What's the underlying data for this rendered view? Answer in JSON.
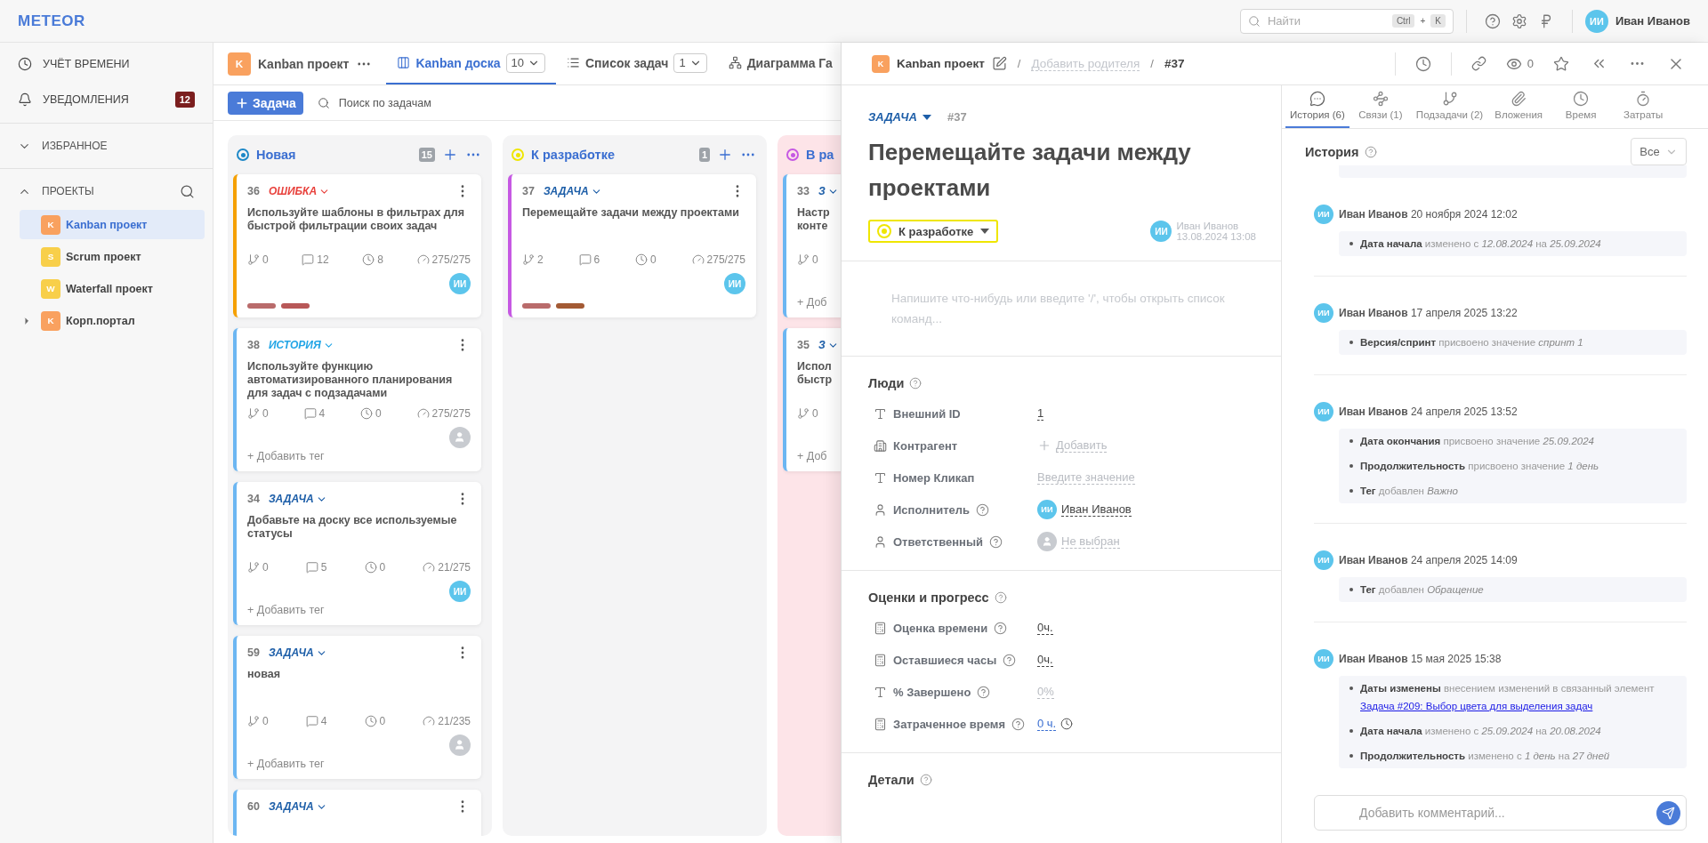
{
  "topbar": {
    "logo": "METEOR",
    "search": {
      "placeholder": "Найти",
      "keys": [
        "Ctrl",
        "+",
        "K"
      ]
    },
    "user": {
      "initials": "ИИ",
      "name": "Иван Иванов"
    }
  },
  "sidebar": {
    "nav": [
      {
        "kind": "timer",
        "label": "УЧЁТ ВРЕМЕНИ"
      },
      {
        "kind": "bell",
        "label": "УВЕДОМЛЕНИЯ",
        "badge": "12"
      }
    ],
    "sections": [
      {
        "label": "ИЗБРАННОЕ",
        "expanded": false,
        "search": false
      },
      {
        "label": "ПРОЕКТЫ",
        "expanded": true,
        "search": true,
        "items": [
          {
            "letter": "K",
            "name": "Kanban проект",
            "color": "#f9a15f",
            "selected": true,
            "expandable": false
          },
          {
            "letter": "S",
            "name": "Scrum проект",
            "color": "#f8cf4a",
            "selected": false,
            "expandable": false
          },
          {
            "letter": "W",
            "name": "Waterfall проект",
            "color": "#f8cf4a",
            "selected": false,
            "expandable": false
          },
          {
            "letter": "K",
            "name": "Корп.портал",
            "color": "#f9a15f",
            "selected": false,
            "expandable": true
          }
        ]
      }
    ]
  },
  "board": {
    "project": {
      "letter": "K",
      "name": "Kanban проект",
      "color": "#f9a15f"
    },
    "views": [
      {
        "kind": "kanban",
        "label": "Kanban доска",
        "count": "10",
        "selected": true
      },
      {
        "kind": "list",
        "label": "Список задач",
        "count": "1",
        "selected": false
      },
      {
        "kind": "gantt",
        "label": "Диаграмма Га",
        "selected": false
      }
    ],
    "new_button": "Задача",
    "search_placeholder": "Поиск по задачам",
    "columns": [
      {
        "title": "Новая",
        "count": "15",
        "color": "#1e88c7",
        "highlighted": false,
        "cards": [
          {
            "number": "36",
            "type": "ОШИБКА",
            "kind": "bug",
            "color": "#f5a000",
            "title": "Используйте шаблоны в фильтрах для быстрой фильтрации своих задач",
            "stats": [
              "0",
              "12",
              "8",
              "275/275"
            ],
            "assignee": {
              "kind": "user",
              "initials": "ИИ"
            },
            "tags": [
              {
                "color": "#b96b6b"
              },
              {
                "color": "#b85858"
              }
            ]
          },
          {
            "number": "38",
            "type": "ИСТОРИЯ",
            "kind": "story",
            "color": "#6cb6f2",
            "title": "Используйте функцию автоматизированного планирования для задач с подзадачами",
            "stats": [
              "0",
              "4",
              "0",
              "275/275"
            ],
            "assignee": {
              "kind": "none"
            },
            "add_tag": "+ Добавить тег"
          },
          {
            "number": "34",
            "type": "ЗАДАЧА",
            "kind": "task",
            "color": "#6cb6f2",
            "title": "Добавьте на доску все используемые статусы",
            "stats": [
              "0",
              "5",
              "0",
              "21/275"
            ],
            "assignee": {
              "kind": "user",
              "initials": "ИИ"
            },
            "add_tag": "+ Добавить тег"
          },
          {
            "number": "59",
            "type": "ЗАДАЧА",
            "kind": "task",
            "color": "#6cb6f2",
            "title": "новая",
            "stats": [
              "0",
              "4",
              "0",
              "21/235"
            ],
            "assignee": {
              "kind": "none"
            },
            "add_tag": "+ Добавить тег"
          },
          {
            "number": "60",
            "type": "ЗАДАЧА",
            "kind": "task",
            "color": "#6cb6f2"
          }
        ]
      },
      {
        "title": "К разработке",
        "count": "1",
        "color": "#efe600",
        "highlighted": false,
        "cards": [
          {
            "number": "37",
            "type": "ЗАДАЧА",
            "kind": "task",
            "color": "#c659e3",
            "title": "Перемещайте задачи между проектами",
            "stats": [
              "2",
              "6",
              "0",
              "275/275"
            ],
            "assignee": {
              "kind": "user",
              "initials": "ИИ"
            },
            "tags": [
              {
                "color": "#b96b6b"
              },
              {
                "color": "#a35a34"
              }
            ]
          }
        ]
      },
      {
        "title": "В ра",
        "color": "#c659e3",
        "highlighted": true,
        "cards": [
          {
            "number": "33",
            "type": "З",
            "kind": "task",
            "color": "#6cb6f2",
            "title": "Настр\nконте",
            "stats": [
              "0"
            ],
            "add_tag": "+ Доб"
          },
          {
            "number": "35",
            "type": "З",
            "kind": "task",
            "color": "#6cb6f2",
            "title": "Испол\nбыстр",
            "stats": [
              "0"
            ],
            "add_tag": "+ Доб"
          }
        ]
      }
    ]
  },
  "task": {
    "project": {
      "letter": "K",
      "name": "Kanban проект",
      "color": "#f9a15f"
    },
    "separator": "/",
    "parent_placeholder": "Добавить родителя",
    "number": "#37",
    "watchers": "0",
    "type": "ЗАДАЧА",
    "type_number": "#37",
    "title": "Перемещайте задачи между проектами",
    "status": {
      "label": "К разработке",
      "color": "#efe600"
    },
    "author": {
      "initials": "ИИ",
      "name": "Иван Иванов",
      "date": "13.08.2024 13:08"
    },
    "description_placeholder": "Напишите что-нибудь или введите '/', чтобы открыть список команд...",
    "sections": [
      {
        "title": "Люди",
        "help": true,
        "fields": [
          {
            "kind": "text",
            "label": "Внешний ID",
            "help": false,
            "value": "1"
          },
          {
            "kind": "contractor",
            "label": "Контрагент",
            "help": false,
            "placeholder": "Добавить",
            "add": true
          },
          {
            "kind": "text",
            "label": "Номер Кликап",
            "help": false,
            "placeholder": "Введите значение"
          },
          {
            "kind": "person",
            "label": "Исполнитель",
            "help": true,
            "value": "Иван Иванов",
            "avatar": {
              "kind": "user",
              "initials": "ИИ"
            }
          },
          {
            "kind": "person",
            "label": "Ответственный",
            "help": true,
            "placeholder": "Не выбран",
            "avatar": {
              "kind": "none"
            }
          }
        ]
      },
      {
        "title": "Оценки и прогресс",
        "help": true,
        "fields": [
          {
            "kind": "number",
            "label": "Оценка времени",
            "help": true,
            "value": "0ч."
          },
          {
            "kind": "number",
            "label": "Оставшиеся часы",
            "help": true,
            "value": "0ч."
          },
          {
            "kind": "text",
            "label": "% Завершено",
            "help": true,
            "placeholder": "0%"
          },
          {
            "kind": "number",
            "label": "Затраченное время",
            "help": true,
            "value": "0 ч.",
            "timer": true
          }
        ]
      },
      {
        "title": "Детали",
        "help": true
      }
    ]
  },
  "history": {
    "tabs": [
      {
        "kind": "history",
        "label": "История (6)",
        "selected": true
      },
      {
        "kind": "links",
        "label": "Связи (1)",
        "selected": false
      },
      {
        "kind": "subtasks",
        "label": "Подзадачи (2)",
        "selected": false
      },
      {
        "kind": "attachments",
        "label": "Вложения",
        "selected": false
      },
      {
        "kind": "time",
        "label": "Время",
        "selected": false
      },
      {
        "kind": "costs",
        "label": "Затраты",
        "selected": false
      }
    ],
    "title": "История",
    "filter": "Все",
    "entries": [
      {
        "initials": "ИИ",
        "author": "Иван Иванов",
        "date": "20 ноября 2024 12:02",
        "changes": [
          {
            "text": "**Дата начала** изменено с *12.08.2024* на *25.09.2024*"
          }
        ]
      },
      {
        "initials": "ИИ",
        "author": "Иван Иванов",
        "date": "17 апреля 2025 13:22",
        "changes": [
          {
            "text": "**Версия/спринт** присвоено значение *спринт 1*"
          }
        ]
      },
      {
        "initials": "ИИ",
        "author": "Иван Иванов",
        "date": "24 апреля 2025 13:52",
        "changes": [
          {
            "text": "**Дата окончания** присвоено значение *25.09.2024*"
          },
          {
            "text": "**Продолжительность** присвоено значение *1 день*"
          },
          {
            "text": "**Тег** добавлен *Важно*"
          }
        ]
      },
      {
        "initials": "ИИ",
        "author": "Иван Иванов",
        "date": "24 апреля 2025 14:09",
        "changes": [
          {
            "text": "**Тег** добавлен *Обращение*"
          }
        ]
      },
      {
        "initials": "ИИ",
        "author": "Иван Иванов",
        "date": "15 мая 2025 15:38",
        "changes": [
          {
            "text": "**Даты изменены** внесением изменений в связанный элемент",
            "link": "Задача #209: Выбор цвета для выделения задач"
          },
          {
            "text": "**Дата начала** изменено с *25.09.2024* на *20.08.2024*"
          },
          {
            "text": "**Продолжительность** изменено с *1 день* на *27 дней*"
          }
        ]
      }
    ],
    "comment_placeholder": "Добавить комментарий..."
  }
}
